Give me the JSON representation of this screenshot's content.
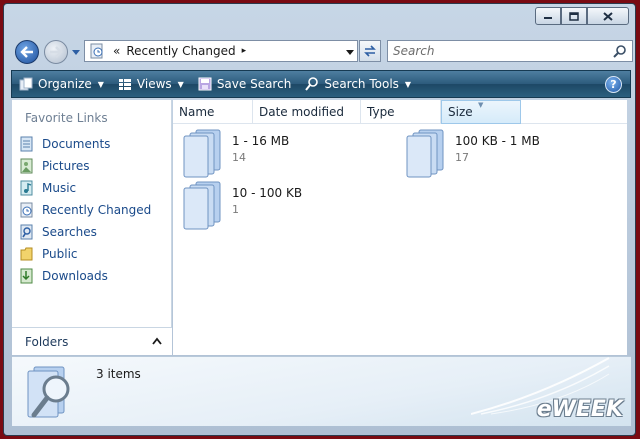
{
  "window": {
    "caption_buttons": [
      "minimize-icon",
      "maximize-icon",
      "close-icon"
    ]
  },
  "navigation": {
    "address": {
      "prefix": "«",
      "current": "Recently Changed",
      "arrow": "▸"
    },
    "search": {
      "placeholder": "Search"
    }
  },
  "toolbar": {
    "items": [
      {
        "label": "Organize",
        "icon": "organize-icon",
        "has_dropdown": true
      },
      {
        "label": "Views",
        "icon": "views-icon",
        "has_dropdown": true
      },
      {
        "label": "Save Search",
        "icon": "save-icon",
        "has_dropdown": false
      },
      {
        "label": "Search Tools",
        "icon": "search-tools-icon",
        "has_dropdown": true
      }
    ],
    "help": "?"
  },
  "sidebar": {
    "title": "Favorite Links",
    "items": [
      {
        "label": "Documents",
        "icon": "documents-icon"
      },
      {
        "label": "Pictures",
        "icon": "pictures-icon"
      },
      {
        "label": "Music",
        "icon": "music-icon"
      },
      {
        "label": "Recently Changed",
        "icon": "recently-changed-icon"
      },
      {
        "label": "Searches",
        "icon": "searches-icon"
      },
      {
        "label": "Public",
        "icon": "public-folder-icon"
      },
      {
        "label": "Downloads",
        "icon": "downloads-icon"
      }
    ],
    "folders_label": "Folders"
  },
  "columns": [
    {
      "label": "Name",
      "active": false
    },
    {
      "label": "Date modified",
      "active": false
    },
    {
      "label": "Type",
      "active": false
    },
    {
      "label": "Size",
      "active": true
    }
  ],
  "groups": [
    {
      "name": "1 - 16 MB",
      "count": "14"
    },
    {
      "name": "100 KB - 1 MB",
      "count": "17"
    },
    {
      "name": "10 - 100 KB",
      "count": "1"
    }
  ],
  "details": {
    "items_count": "3 items"
  },
  "watermark": "eWEEK",
  "colors": {
    "toolbar": "#2c5b7c",
    "link": "#1a4a8a",
    "frame": "#7a0a12"
  }
}
